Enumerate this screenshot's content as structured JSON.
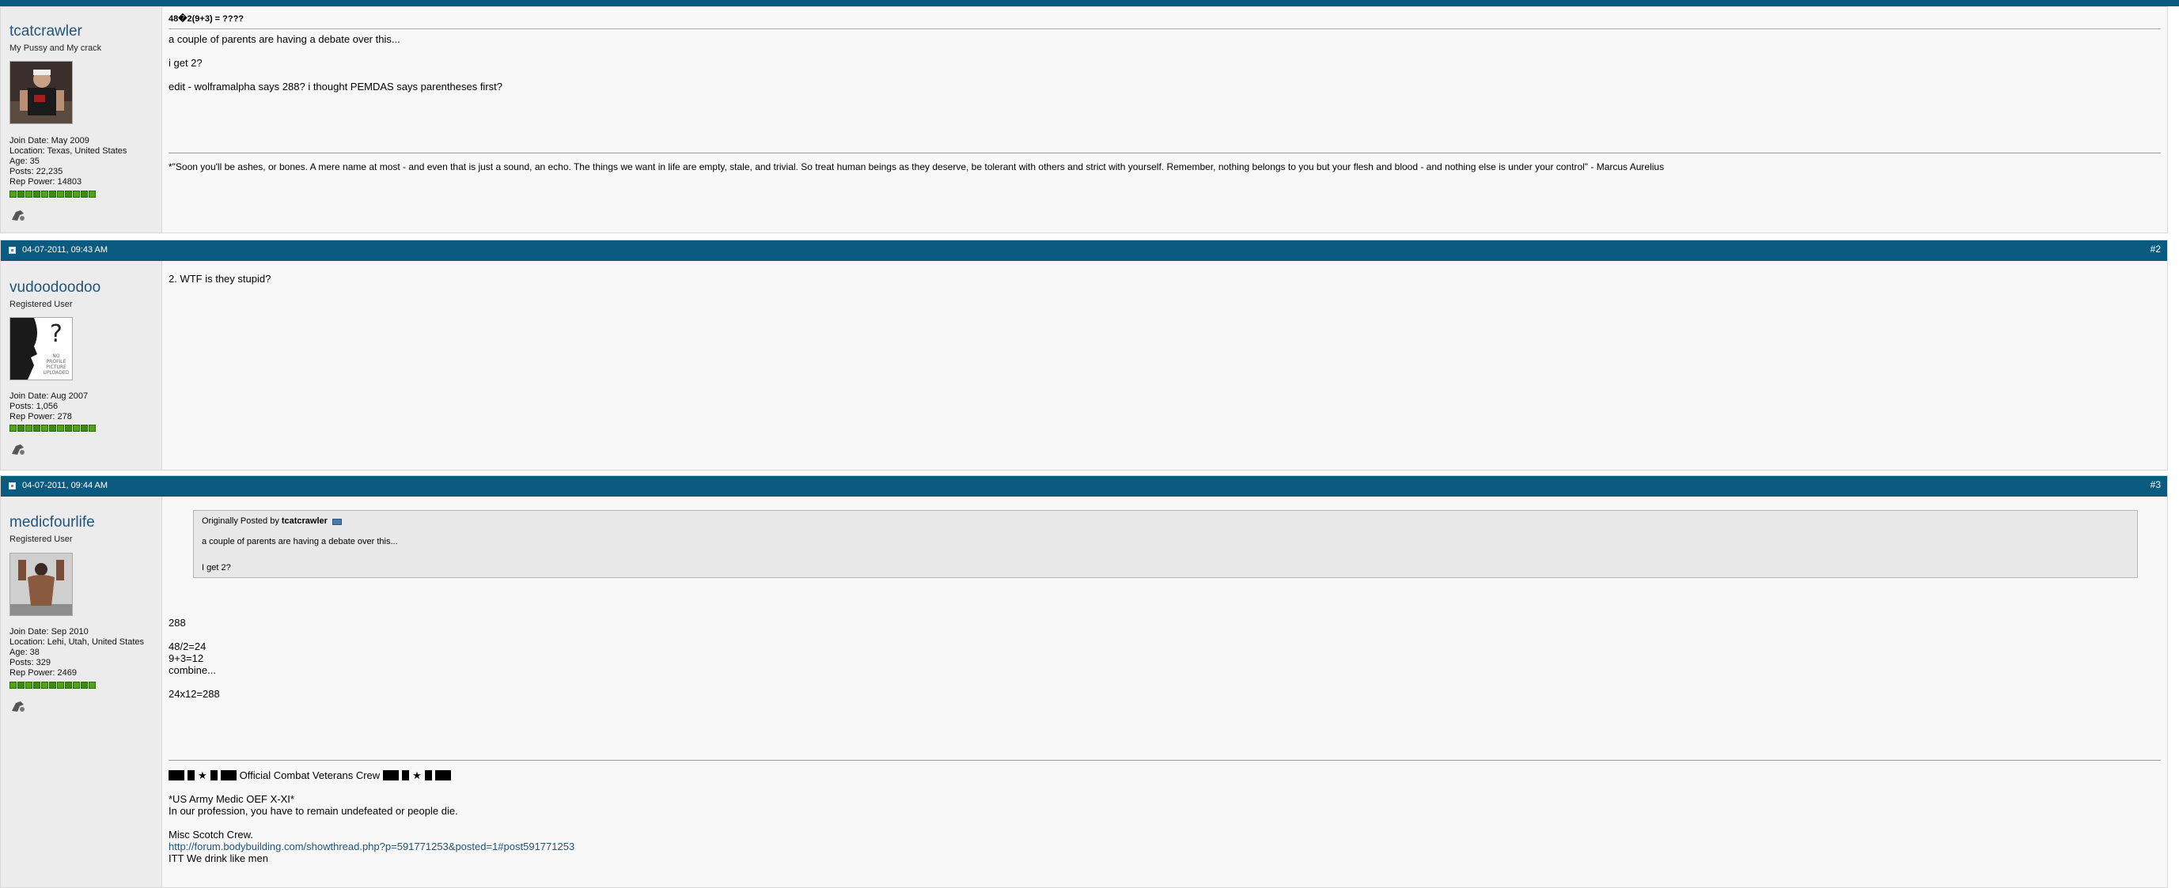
{
  "posts": [
    {
      "username": "tcatcrawler",
      "user_title": "My Pussy and My crack",
      "join_date": "Join Date: May 2009",
      "location": "Location: Texas, United States",
      "age": "Age: 35",
      "posts": "Posts: 22,235",
      "rep_power": "Rep Power: 14803",
      "title": "48�2(9+3) = ????",
      "body": [
        "a couple of parents are having a debate over this...",
        "i get 2?",
        "edit - wolframalpha says 288? i thought PEMDAS says parentheses first?"
      ],
      "signature": "*\"Soon you'll be ashes, or bones. A mere name at most - and even that is just a sound, an echo. The things we want in life are empty, stale, and trivial. So treat human beings as they deserve, be tolerant with others and strict with yourself. Remember, nothing belongs to you but your flesh and blood - and nothing else is under your control\" - Marcus Aurelius"
    },
    {
      "date": "04-07-2011, 09:43 AM",
      "number": "#2",
      "username": "vudoodoodoo",
      "user_title": "Registered User",
      "avatar_text": "NO PROFILE PICTURE UPLOADED",
      "join_date": "Join Date: Aug 2007",
      "posts": "Posts: 1,056",
      "rep_power": "Rep Power: 278",
      "body": [
        "2. WTF is they stupid?"
      ]
    },
    {
      "date": "04-07-2011, 09:44 AM",
      "number": "#3",
      "username": "medicfourlife",
      "user_title": "Registered User",
      "join_date": "Join Date: Sep 2010",
      "location": "Location: Lehi, Utah, United States",
      "age": "Age: 38",
      "posts": "Posts: 329",
      "rep_power": "Rep Power: 2469",
      "quote": {
        "prefix": "Originally Posted by",
        "author": "tcatcrawler",
        "lines": [
          "a couple of parents are having a debate over this...",
          "I get 2?"
        ]
      },
      "body": [
        "288",
        "48/2=24",
        "9+3=12",
        "combine...",
        "24x12=288"
      ],
      "signature": {
        "crew": "Official Combat Veterans Crew",
        "line1": "*US Army Medic OEF X-XI*",
        "line2": "In our profession, you have to remain undefeated or people die.",
        "line3": "Misc Scotch Crew.",
        "link": "http://forum.bodybuilding.com/showthread.php?p=591771253&posted=1#post591771253",
        "line4": "ITT We drink like men"
      }
    }
  ],
  "colors": {
    "header": "#0b5a80",
    "username": "#22547a",
    "rep": "#53a31a"
  },
  "icons": [
    "post-icon",
    "add-to-reputation-icon",
    "view-post-icon"
  ]
}
